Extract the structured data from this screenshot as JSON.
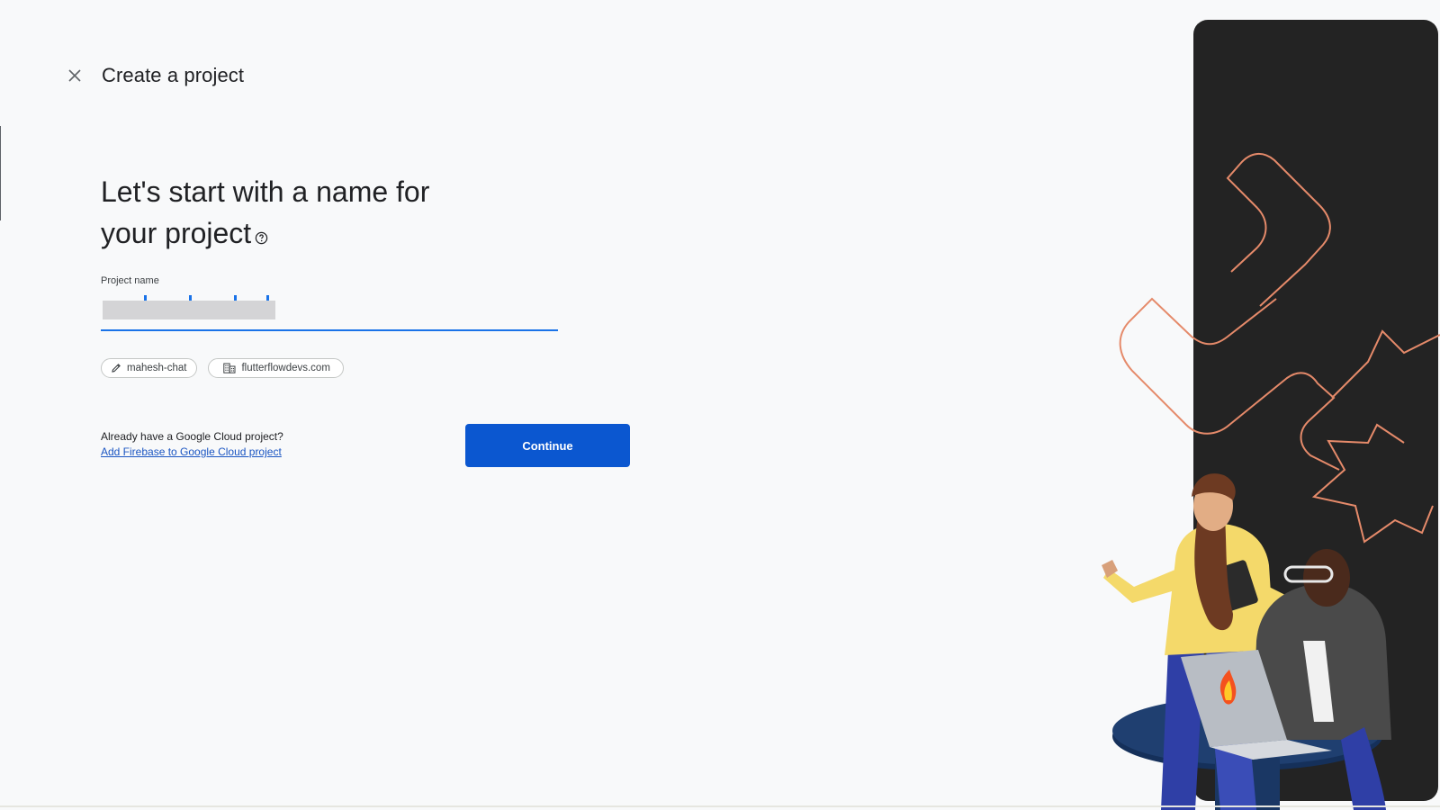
{
  "header": {
    "title": "Create a project",
    "close_icon": "close-icon"
  },
  "main": {
    "headline_line1": "Let's start with a name for",
    "headline_line2": "your project",
    "help_icon": "help-circle-icon"
  },
  "project_name": {
    "label": "Project name",
    "value": "",
    "redacted": true
  },
  "chips": [
    {
      "icon": "pencil-icon",
      "label": "mahesh-chat"
    },
    {
      "icon": "building-icon",
      "label": "flutterflowdevs.com"
    }
  ],
  "cloud": {
    "question": "Already have a Google Cloud project?",
    "link": "Add Firebase to Google Cloud project"
  },
  "actions": {
    "continue_label": "Continue"
  },
  "colors": {
    "primary": "#0b57d0",
    "accent": "#1a73e8",
    "background": "#f8f9fa",
    "dark_panel": "#232323",
    "orange_outline": "#e58a6a"
  }
}
